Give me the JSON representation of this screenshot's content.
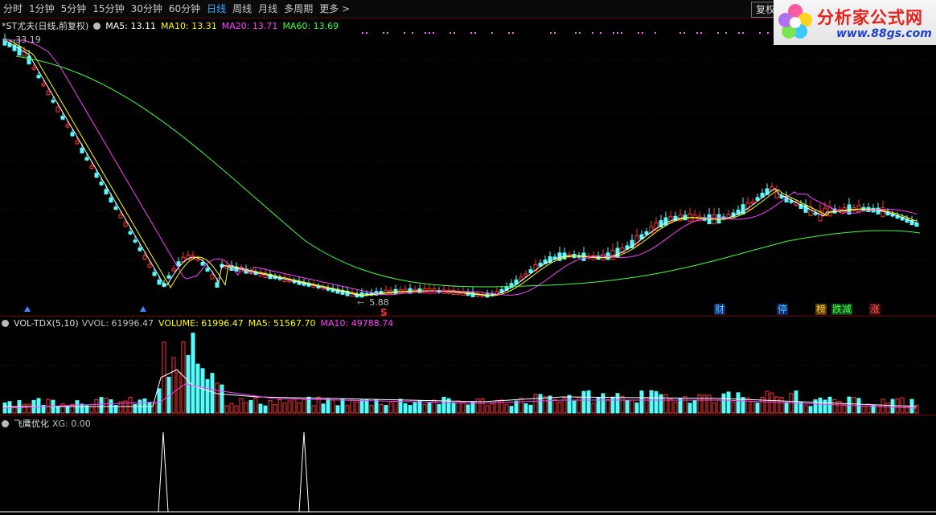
{
  "toolbar": {
    "tabs": [
      "分时",
      "1分钟",
      "5分钟",
      "15分钟",
      "30分钟",
      "60分钟",
      "日线",
      "周线",
      "月线",
      "多周期",
      "更多 >"
    ],
    "active_tab": 6,
    "fuquan": "复权"
  },
  "logo": {
    "title": "分析家公式网",
    "url": "www.88gs.com"
  },
  "main_panel": {
    "stock_name": "*ST尤夫(日线,前复权)",
    "indicators": [
      {
        "label": "MA5: 13.11",
        "color": "#ffffff"
      },
      {
        "label": "MA10: 13.31",
        "color": "#ffff00"
      },
      {
        "label": "MA20: 13.71",
        "color": "#ff40ff"
      },
      {
        "label": "MA60: 13.69",
        "color": "#40ff40"
      }
    ],
    "high_label": "33.19",
    "low_label": "5.88",
    "s_marker": "S",
    "annotations": [
      {
        "text": "财",
        "bg": "#0a2a6a",
        "color": "#5ac8ff"
      },
      {
        "text": "停",
        "bg": "#0a2a6a",
        "color": "#5ac8ff"
      },
      {
        "text": "榜",
        "bg": "#5a3a00",
        "color": "#ffd040"
      },
      {
        "text": "跌减",
        "bg": "#0a4a1a",
        "color": "#50ff50"
      },
      {
        "text": "涨",
        "bg": "#4a0a0a",
        "color": "#ff6060"
      }
    ]
  },
  "vol_panel": {
    "name": "VOL-TDX(5,10)",
    "indicators": [
      {
        "label": "VVOL: 61996.47",
        "color": "#c0c0c0"
      },
      {
        "label": "VOLUME: 61996.47",
        "color": "#ffff00"
      },
      {
        "label": "MA5: 51567.70",
        "color": "#ffff00"
      },
      {
        "label": "MA10: 49788.74",
        "color": "#ff40ff"
      }
    ]
  },
  "xg_panel": {
    "name": "飞鹰优化",
    "indicators": [
      {
        "label": "XG: 0.00",
        "color": "#c0c0c0"
      }
    ]
  },
  "colors": {
    "up": "#ff3232",
    "down": "#54fcfc",
    "ma5": "#ffffff",
    "ma10": "#ffff00",
    "ma20": "#ff40ff",
    "ma60": "#40ff40"
  }
}
